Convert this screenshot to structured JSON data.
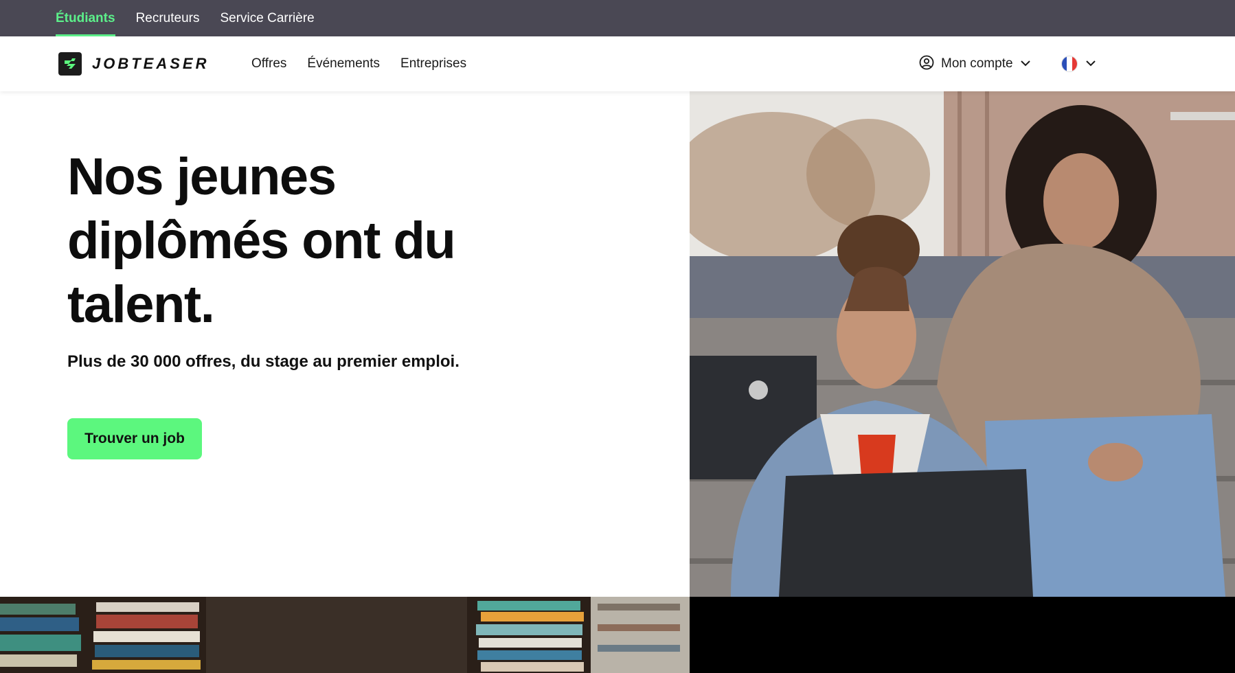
{
  "audience_tabs": [
    {
      "label": "Étudiants",
      "active": true
    },
    {
      "label": "Recruteurs",
      "active": false
    },
    {
      "label": "Service Carrière",
      "active": false
    }
  ],
  "header": {
    "logo_text": "JOBTEASER",
    "nav": [
      {
        "label": "Offres"
      },
      {
        "label": "Événements"
      },
      {
        "label": "Entreprises"
      }
    ],
    "account_label": "Mon compte",
    "account_icon": "user-circle-icon",
    "language_icon": "france-flag-icon"
  },
  "hero": {
    "title": "Nos jeunes diplômés ont du talent.",
    "subtitle": "Plus de 30 000 offres, du stage au premier emploi.",
    "cta_label": "Trouver un job"
  },
  "colors": {
    "accent_green": "#5cf77e",
    "active_tab_green": "#5cf08a",
    "top_bar_bg": "#4a4854",
    "text_dark": "#111111"
  }
}
